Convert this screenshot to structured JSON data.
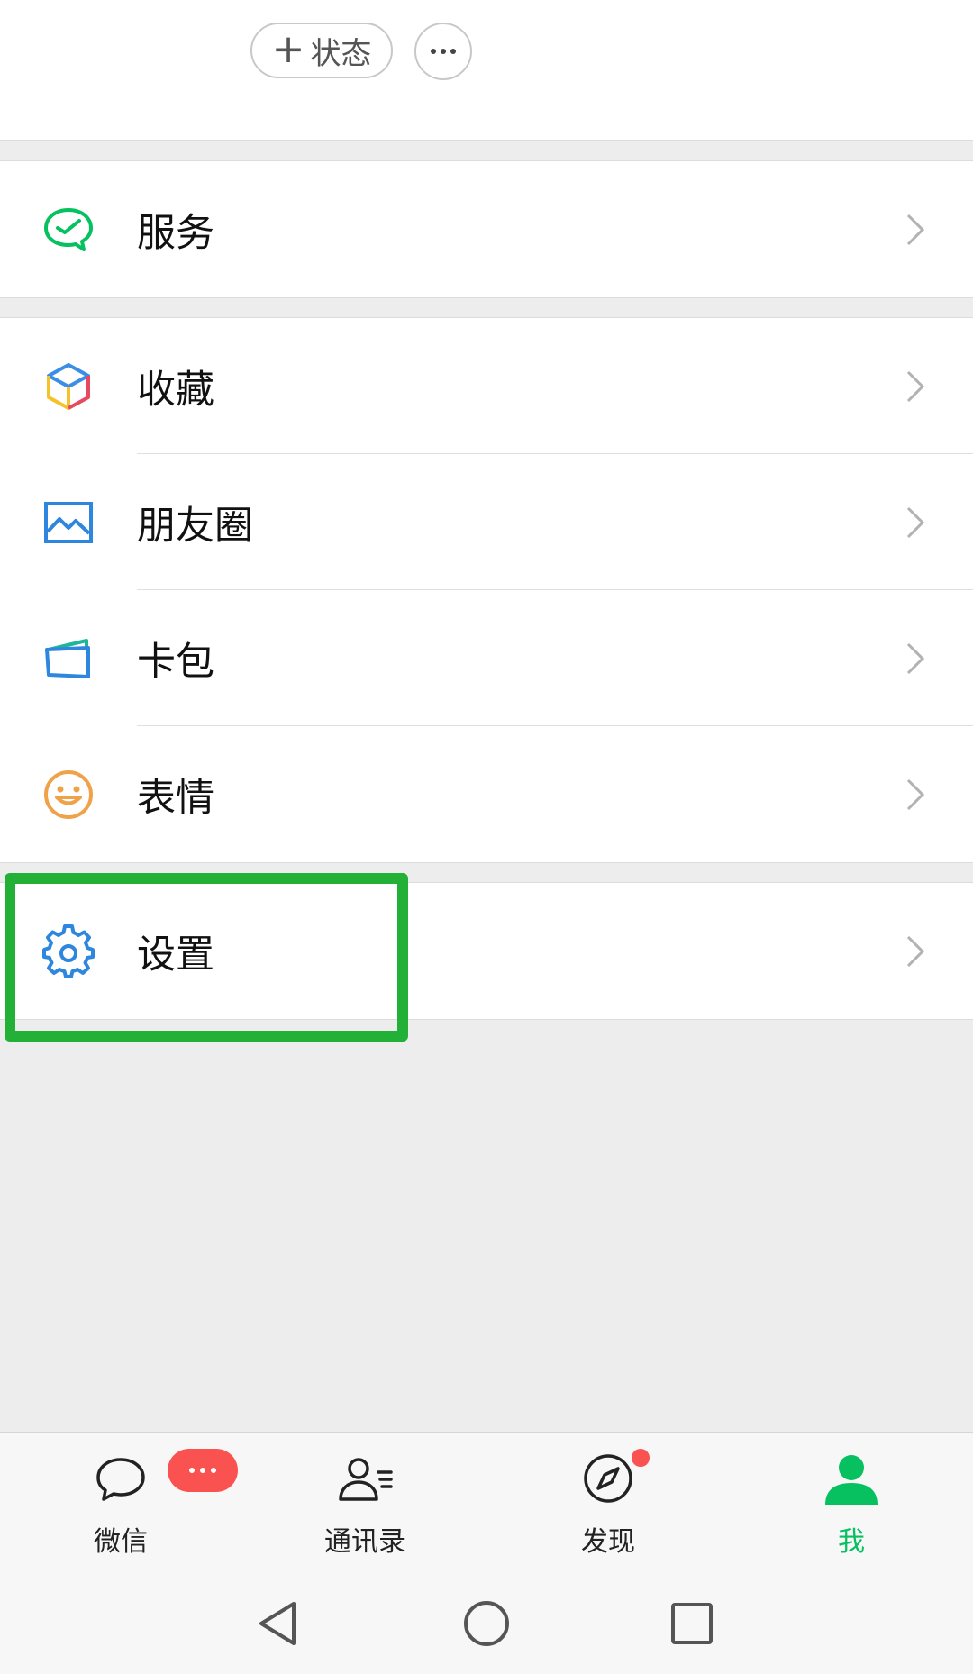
{
  "top": {
    "status_button": {
      "plus": "+",
      "label": "状态"
    },
    "more_button_icon": "ellipsis-icon"
  },
  "menu": {
    "services": {
      "label": "服务",
      "icon": "wechat-pay-icon"
    },
    "favorites": {
      "label": "收藏",
      "icon": "cube-icon"
    },
    "moments": {
      "label": "朋友圈",
      "icon": "picture-icon"
    },
    "cards": {
      "label": "卡包",
      "icon": "card-wallet-icon"
    },
    "stickers": {
      "label": "表情",
      "icon": "smiley-icon"
    },
    "settings": {
      "label": "设置",
      "icon": "gear-icon",
      "highlighted": true
    }
  },
  "tabbar": {
    "tabs": [
      {
        "label": "微信",
        "icon": "chat-bubble-icon",
        "badge": "···"
      },
      {
        "label": "通讯录",
        "icon": "contacts-icon"
      },
      {
        "label": "发现",
        "icon": "compass-icon",
        "dot": true
      },
      {
        "label": "我",
        "icon": "person-icon",
        "active": true
      }
    ]
  },
  "colors": {
    "accent": "#07c160",
    "badge": "#fa5151",
    "highlight_box": "#22b037",
    "background": "#ededed"
  }
}
